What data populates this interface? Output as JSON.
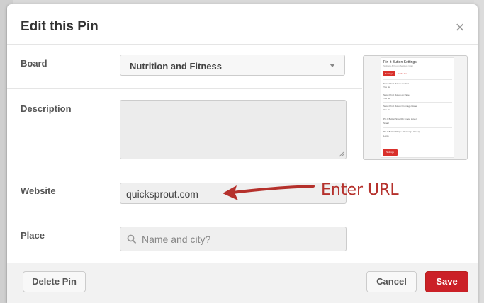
{
  "modal": {
    "title": "Edit this Pin",
    "close_icon": "×"
  },
  "form": {
    "board": {
      "label": "Board",
      "value": "Nutrition and Fitness"
    },
    "description": {
      "label": "Description",
      "value": ""
    },
    "website": {
      "label": "Website",
      "value": "quicksprout.com"
    },
    "place": {
      "label": "Place",
      "placeholder": "Name and city?"
    }
  },
  "preview": {
    "title": "Pin It Button Settings",
    "subtitle": "Settings & Plugin Settings Grab",
    "settings_button": "Settings",
    "link": "Grab Here",
    "options": [
      {
        "label": "Show Pin It Button on Post",
        "choices": "Yes  No"
      },
      {
        "label": "Show Pin It Button on Page",
        "choices": "Yes  No"
      },
      {
        "label": "Show Pin It Button On Image Hover",
        "choices": "Yes  No"
      },
      {
        "label": "Pin It Button Size (On Image Hover)",
        "select": "Small"
      },
      {
        "label": "Pin It Button Shape (On Image Hover)",
        "select": "Large"
      }
    ],
    "save_button": "Settings"
  },
  "footer": {
    "delete_label": "Delete Pin",
    "cancel_label": "Cancel",
    "save_label": "Save"
  },
  "annotation": {
    "text": "Enter URL",
    "color": "#b5312c"
  },
  "colors": {
    "save_button": "#cb2027",
    "accent_red": "#d9302b"
  }
}
